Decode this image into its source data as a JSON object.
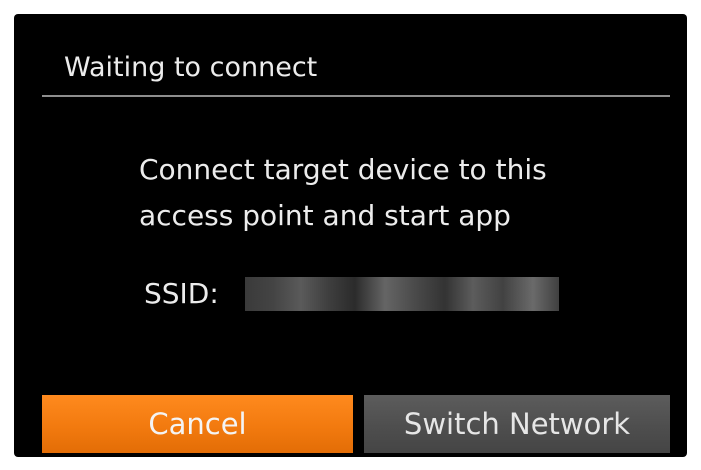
{
  "dialog": {
    "title": "Waiting to connect",
    "message_line1": "Connect target device to this",
    "message_line2": "access point and start app",
    "ssid_label": "SSID:",
    "ssid_value": "",
    "cancel_label": "Cancel",
    "switch_network_label": "Switch Network"
  },
  "colors": {
    "background": "#000000",
    "text": "#ececec",
    "cancel_button": "#f27a0f",
    "switch_button": "#4e4e4e",
    "divider": "#8e8e8e"
  }
}
